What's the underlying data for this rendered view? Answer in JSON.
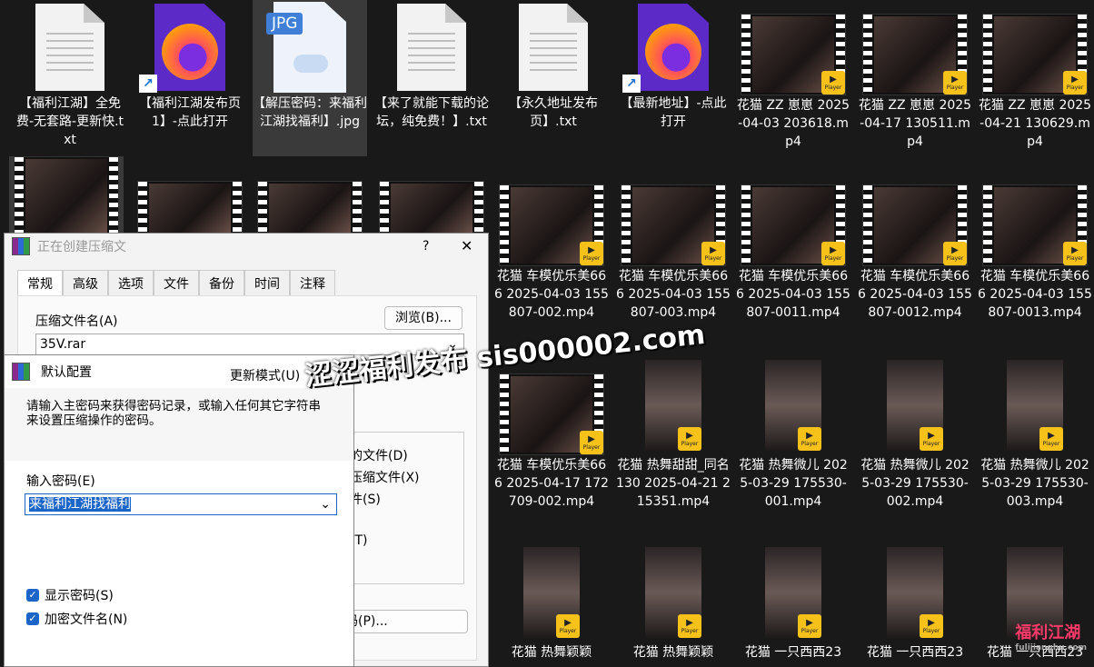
{
  "files": [
    {
      "kind": "doc",
      "label": "【福利江湖】全免费-无套路-更新快.txt"
    },
    {
      "kind": "firefox",
      "shortcut": true,
      "label": "【福利江湖发布页1】-点此打开"
    },
    {
      "kind": "jpg",
      "selected": true,
      "icon_text": "JPG",
      "label": "【解压密码：来福利江湖找福利】.jpg"
    },
    {
      "kind": "doc",
      "label": "【来了就能下载的论坛，纯免费！】.txt"
    },
    {
      "kind": "doc",
      "label": "【永久地址发布页】.txt"
    },
    {
      "kind": "firefox",
      "shortcut": true,
      "label": "【最新地址】-点此打开"
    },
    {
      "kind": "film",
      "label": "花猫 ZZ 崽崽 2025-04-03 203618.mp4"
    },
    {
      "kind": "film",
      "label": "花猫 ZZ 崽崽 2025-04-17 130511.mp4"
    },
    {
      "kind": "film",
      "label": "花猫 ZZ 崽崽 2025-04-21 130629.mp4"
    }
  ],
  "row2": [
    {
      "label": "花猫 车模优乐美666 2025-04-03 155807-002.mp4"
    },
    {
      "label": "花猫 车模优乐美666 2025-04-03 155807-003.mp4"
    },
    {
      "label": "花猫 车模优乐美666 2025-04-03 155807-0011.mp4"
    },
    {
      "label": "花猫 车模优乐美666 2025-04-03 155807-0012.mp4"
    },
    {
      "label": "花猫 车模优乐美666 2025-04-03 155807-0013.mp4"
    }
  ],
  "row3": [
    {
      "kind": "film",
      "label": "花猫 车模优乐美666 2025-04-17 172709-002.mp4"
    },
    {
      "kind": "vert",
      "label": "花猫 热舞甜甜_同名130 2025-04-21 215351.mp4"
    },
    {
      "kind": "vert",
      "label": "花猫 热舞微儿 2025-03-29 175530-001.mp4"
    },
    {
      "kind": "vert",
      "label": "花猫 热舞微儿 2025-03-29 175530-002.mp4"
    },
    {
      "kind": "vert",
      "label": "花猫 热舞微儿 2025-03-29 175530-003.mp4"
    }
  ],
  "row4": [
    {
      "label": "花猫 热舞颖颖"
    },
    {
      "label": "花猫 热舞颖颖"
    },
    {
      "label": "花猫 一只西西23"
    },
    {
      "label": "花猫 一只西西23"
    },
    {
      "label": "花猫 一只西西23"
    }
  ],
  "badge": {
    "text": "Player"
  },
  "archive_dialog": {
    "title": "正在创建压缩文",
    "help": "?",
    "close": "✕",
    "tabs": [
      "常规",
      "高级",
      "选项",
      "文件",
      "备份",
      "时间",
      "注释"
    ],
    "archive_name_label": "压缩文件名(A)",
    "browse": "浏览(B)...",
    "archive_name": "35V.rar",
    "opt1": "的文件(D)",
    "opt2": "压缩文件(X)",
    "opt3": "件(S)",
    "opt4": "(T)",
    "btn_tail": "码(P)..."
  },
  "pw_dialog": {
    "title": "默认配置",
    "mode": "更新模式(U)",
    "prompt": "请输入主密码来获得密码记录，或输入任何其它字符串来设置压缩操作的密码。",
    "pw_label": "输入密码(E)",
    "pw_value": "来福利江湖找福利",
    "show_pw": "显示密码(S)",
    "encrypt_names": "加密文件名(N)"
  },
  "watermark": "涩涩福利发布 sis000002.com",
  "logo": {
    "text": "福利江湖",
    "sub": "fulijianghu.com"
  }
}
